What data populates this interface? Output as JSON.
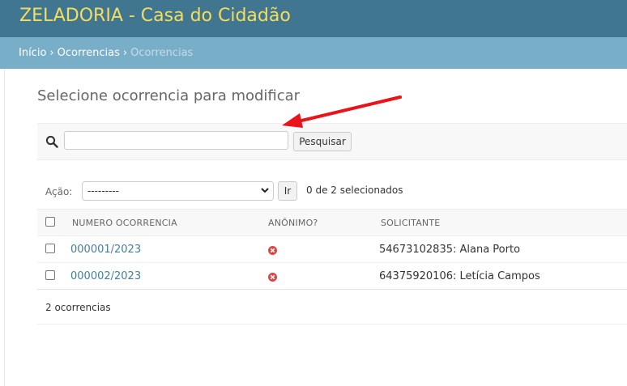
{
  "app": {
    "title": "ZELADORIA - Casa do Cidadão"
  },
  "breadcrumbs": {
    "home": "Início",
    "section": "Ocorrencias",
    "current": "Ocorrencias",
    "separator": "›"
  },
  "page": {
    "title": "Selecione ocorrencia para modificar"
  },
  "search": {
    "value": "",
    "placeholder": "",
    "button_label": "Pesquisar"
  },
  "actions": {
    "label": "Ação:",
    "selected_option": "---------",
    "go_label": "Ir",
    "selected_count": "0 de 2 selecionados"
  },
  "table": {
    "columns": [
      "NUMERO OCORRENCIA",
      "ANÔNIMO?",
      "SOLICITANTE"
    ],
    "rows": [
      {
        "numero": "000001/2023",
        "anonimo": false,
        "solicitante": "54673102835: Alana Porto"
      },
      {
        "numero": "000002/2023",
        "anonimo": false,
        "solicitante": "64375920106: Letícia Campos"
      }
    ]
  },
  "footer": {
    "count": "2 ocorrencias"
  },
  "colors": {
    "header": "#417690",
    "brand": "#f5dd5d",
    "breadcrumbs": "#79aec8",
    "link": "#447e9b",
    "no_icon": "#dd4646",
    "arrow": "#e8141a"
  },
  "icons": {
    "search": "search-icon",
    "anonimo_no": "no-icon",
    "annotation": "red-arrow-annotation"
  }
}
